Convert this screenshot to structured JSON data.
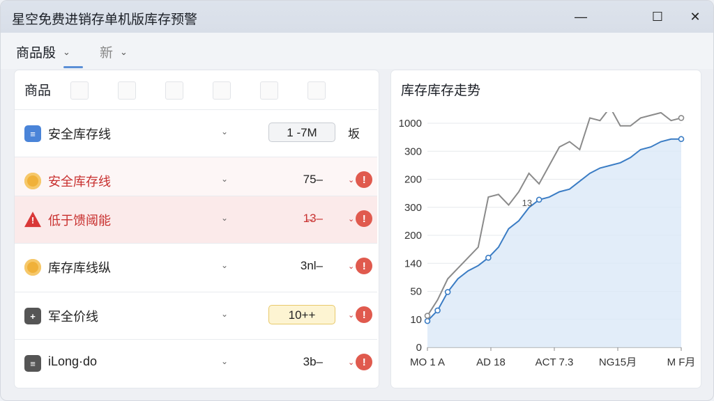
{
  "window": {
    "title": "星空免费进销存单机版库存预警"
  },
  "toolbar": {
    "tab1": "商品殷",
    "tab2": "新"
  },
  "left_panel": {
    "title": "商品",
    "rows": [
      {
        "name": "安全库存线",
        "value": "1 -7M",
        "action": "坂",
        "style": "normal",
        "icon": "doc-icon"
      },
      {
        "name": "安全库存线",
        "value": "75–",
        "action": "",
        "style": "soft",
        "icon": "gold-icon"
      },
      {
        "name": "低于馈阈能",
        "value": "1̶3–",
        "action": "",
        "style": "alert",
        "icon": "warning-icon"
      },
      {
        "name": "库存库线纵",
        "value": "3nl–",
        "action": "",
        "style": "normal",
        "icon": "gold-icon"
      },
      {
        "name": "军全价线",
        "value": "10++",
        "action": "",
        "style": "normal",
        "icon": "grid-icon"
      },
      {
        "name": "iLong·do",
        "value": "3b–",
        "action": "",
        "style": "normal",
        "icon": "list-icon"
      }
    ]
  },
  "right_panel": {
    "title": "库存库存走势"
  },
  "chart_data": {
    "type": "line",
    "title": "库存库存走势",
    "y_ticks": [
      "0",
      "10",
      "50",
      "140",
      "200",
      "300",
      "200",
      "300",
      "1000"
    ],
    "x_ticks": [
      "MO 1 A",
      "AD 18",
      "ACT 7.3",
      "NG15月",
      "M F月"
    ],
    "annotation": "13",
    "series": [
      {
        "values": [
          1.0,
          1.4,
          2.1,
          2.6,
          2.9,
          3.1,
          3.4,
          3.8,
          4.5,
          4.8,
          5.3,
          5.6,
          5.7,
          5.9,
          6.0,
          6.3,
          6.6,
          6.8,
          6.9,
          7.0,
          7.2,
          7.5,
          7.6,
          7.8,
          7.9,
          7.9
        ]
      },
      {
        "values": [
          1.2,
          1.8,
          2.6,
          3.0,
          3.4,
          3.8,
          5.7,
          5.8,
          5.4,
          5.9,
          6.6,
          6.2,
          6.9,
          7.6,
          7.8,
          7.5,
          8.7,
          8.6,
          9.1,
          8.4,
          8.4,
          8.7,
          8.8,
          8.9,
          8.6,
          8.7
        ]
      }
    ],
    "colors": {
      "series1": "#3a7cc4",
      "series2": "#8a8a8a",
      "fill": "#dbe8f7"
    }
  }
}
